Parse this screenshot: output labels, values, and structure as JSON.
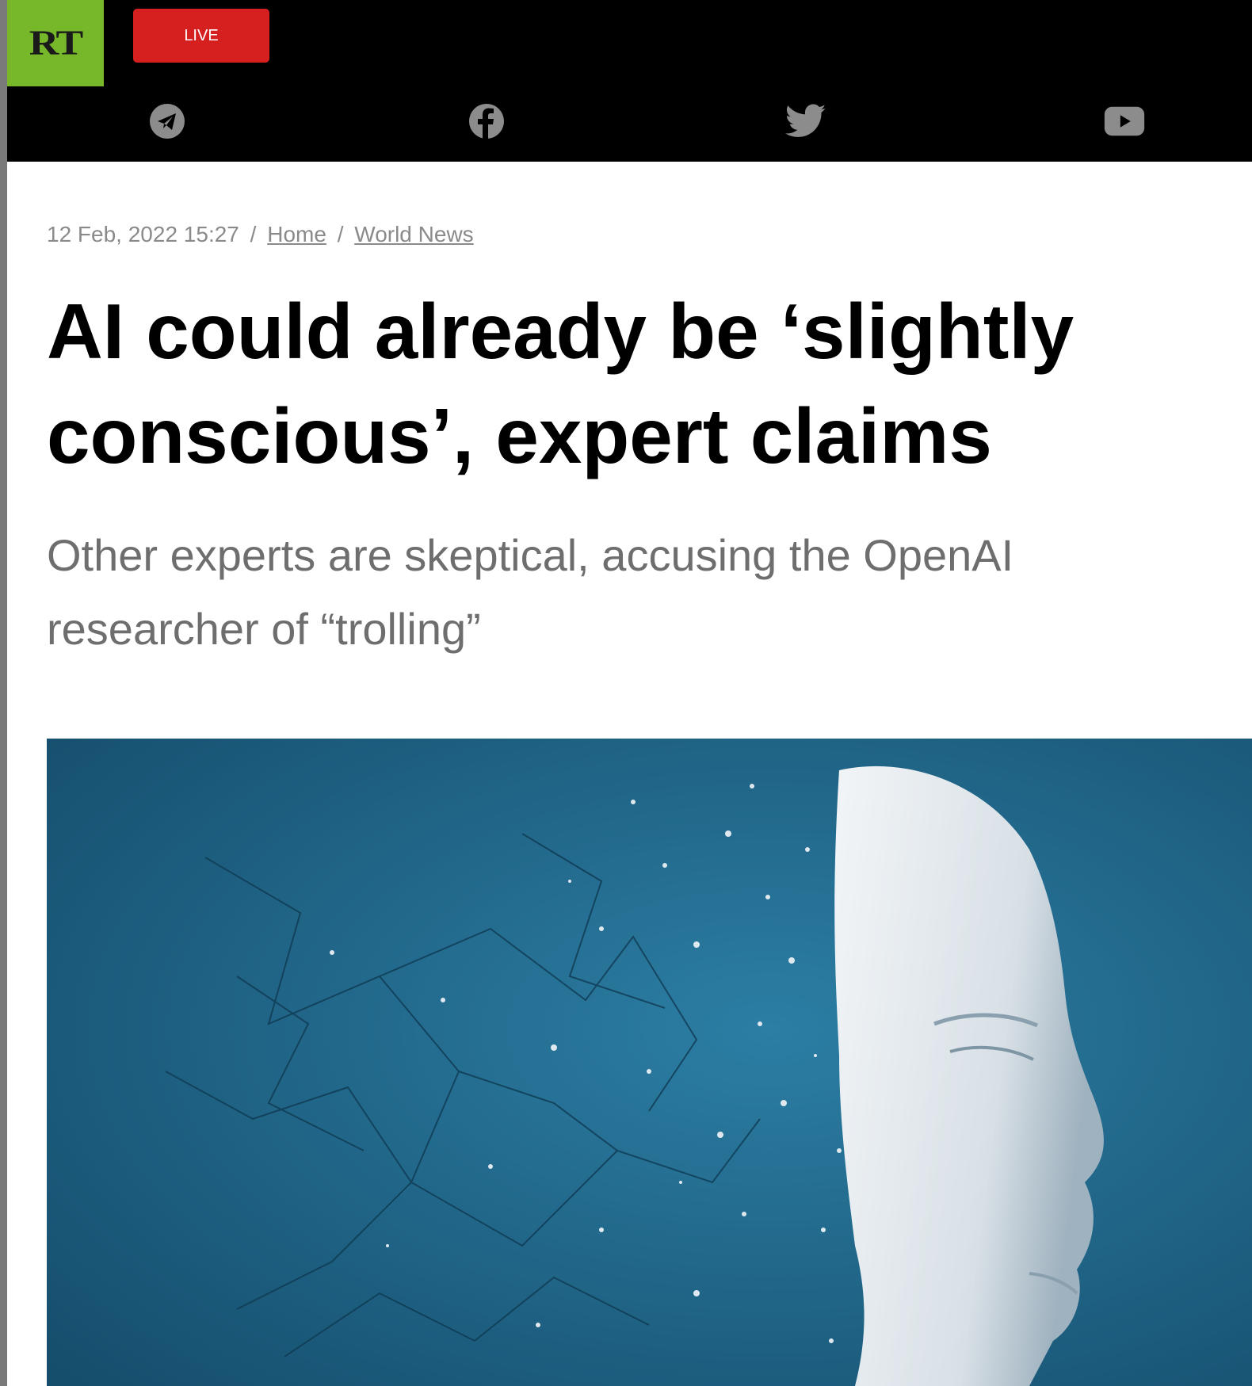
{
  "header": {
    "logo_text": "RT",
    "live_label": "LIVE",
    "social": [
      {
        "icon": "telegram-icon"
      },
      {
        "icon": "facebook-icon"
      },
      {
        "icon": "twitter-icon"
      },
      {
        "icon": "youtube-icon"
      }
    ]
  },
  "article": {
    "date": "12 Feb, 2022 15:27",
    "breadcrumb": {
      "separator": "/",
      "home": "Home",
      "section": "World News"
    },
    "headline": "AI could already be ‘slightly conscious’, expert claims",
    "subheadline": "Other experts are skeptical, accusing the OpenAI researcher of “trolling”",
    "hero_image": {
      "subject": "white humanoid face dissolving into particles and network lines",
      "colors": {
        "background": "#1c5f82",
        "background_light": "#2c7ea4",
        "face": "#e9eef1"
      }
    }
  },
  "colors": {
    "header_bg": "#000000",
    "logo_bg": "#77b82a",
    "live_bg": "#d62020",
    "icon_gray": "#8c8c8c",
    "headline": "#000000",
    "subheadline": "#6e6e6e",
    "meta": "#8a8a8a"
  }
}
